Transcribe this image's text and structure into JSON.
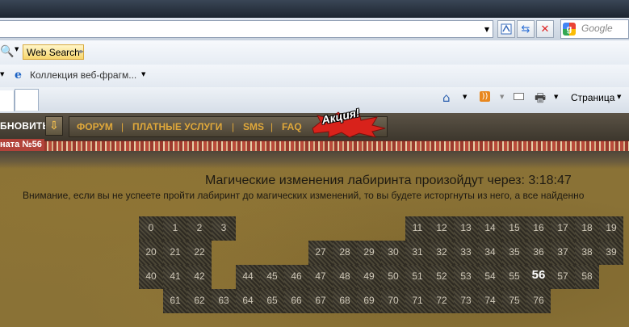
{
  "browser": {
    "search_placeholder": "Google",
    "web_search_label": "Web Search",
    "favorite_label": "Коллекция веб-фрагм...",
    "page_menu_label": "Страница"
  },
  "game": {
    "refresh_label": "БНОВИТЬ",
    "nav_links": [
      "ФОРУМ",
      "ПЛАТНЫЕ УСЛУГИ",
      "SMS",
      "FAQ"
    ],
    "promo_label": "Акция!",
    "room_label": "ната №56"
  },
  "maze": {
    "timer_text": "Магические изменения лабиринта произойдут через: 3:18:47",
    "warning_text": "Внимание, если вы не успеете пройти лабиринт до магических изменений, то вы будете исторгнуты из него, а все найденно",
    "current_cell": 56,
    "rows": [
      [
        0,
        1,
        2,
        3,
        null,
        null,
        null,
        null,
        null,
        null,
        null,
        11,
        12,
        13,
        14,
        15,
        16,
        17,
        18,
        19
      ],
      [
        20,
        21,
        22,
        null,
        null,
        null,
        null,
        27,
        28,
        29,
        30,
        31,
        32,
        33,
        34,
        35,
        36,
        37,
        38,
        39
      ],
      [
        40,
        41,
        42,
        null,
        44,
        45,
        46,
        47,
        48,
        49,
        50,
        51,
        52,
        53,
        54,
        55,
        56,
        57,
        58,
        null
      ],
      [
        null,
        61,
        62,
        63,
        64,
        65,
        66,
        67,
        68,
        69,
        70,
        71,
        72,
        73,
        74,
        75,
        76,
        null,
        null,
        null
      ]
    ]
  }
}
